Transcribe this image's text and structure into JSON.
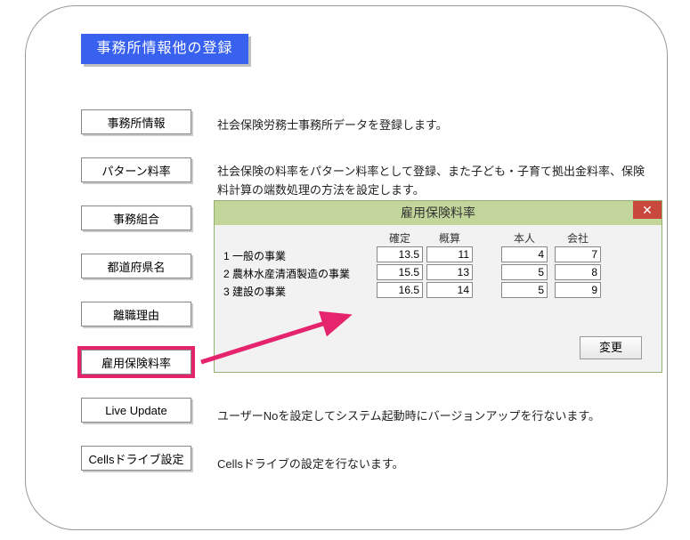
{
  "header": {
    "title": "事務所情報他の登録"
  },
  "nav": [
    {
      "label": "事務所情報"
    },
    {
      "label": "パターン料率"
    },
    {
      "label": "事務組合"
    },
    {
      "label": "都道府県名"
    },
    {
      "label": "離職理由"
    },
    {
      "label": "雇用保険料率"
    },
    {
      "label": "Live Update"
    },
    {
      "label": "Cellsドライブ設定"
    }
  ],
  "descriptions": {
    "d0": "社会保険労務士事務所データを登録します。",
    "d1": "社会保険の料率をパターン料率として登録、また子ども・子育て拠出金料率、保険料計算の端数処理の方法を設定します。",
    "d6": "ユーザーNoを設定してシステム起動時にバージョンアップを行ないます。",
    "d7": "Cellsドライブの設定を行ないます。"
  },
  "dialog": {
    "title": "雇用保険料率",
    "close": "✕",
    "headers": {
      "kakutei": "確定",
      "gaisan": "概算",
      "honnin": "本人",
      "kaisha": "会社"
    },
    "rows": [
      {
        "label": "1 一般の事業",
        "v": [
          "13.5",
          "11",
          "4",
          "7"
        ]
      },
      {
        "label": "2 農林水産清酒製造の事業",
        "v": [
          "15.5",
          "13",
          "5",
          "8"
        ]
      },
      {
        "label": "3 建設の事業",
        "v": [
          "16.5",
          "14",
          "5",
          "9"
        ]
      }
    ],
    "change": "変更"
  },
  "chart_data": {
    "type": "table",
    "title": "雇用保険料率",
    "columns": [
      "確定",
      "概算",
      "本人",
      "会社"
    ],
    "rows": [
      {
        "label": "一般の事業",
        "values": [
          13.5,
          11,
          4,
          7
        ]
      },
      {
        "label": "農林水産清酒製造の事業",
        "values": [
          15.5,
          13,
          5,
          8
        ]
      },
      {
        "label": "建設の事業",
        "values": [
          16.5,
          14,
          5,
          9
        ]
      }
    ]
  }
}
